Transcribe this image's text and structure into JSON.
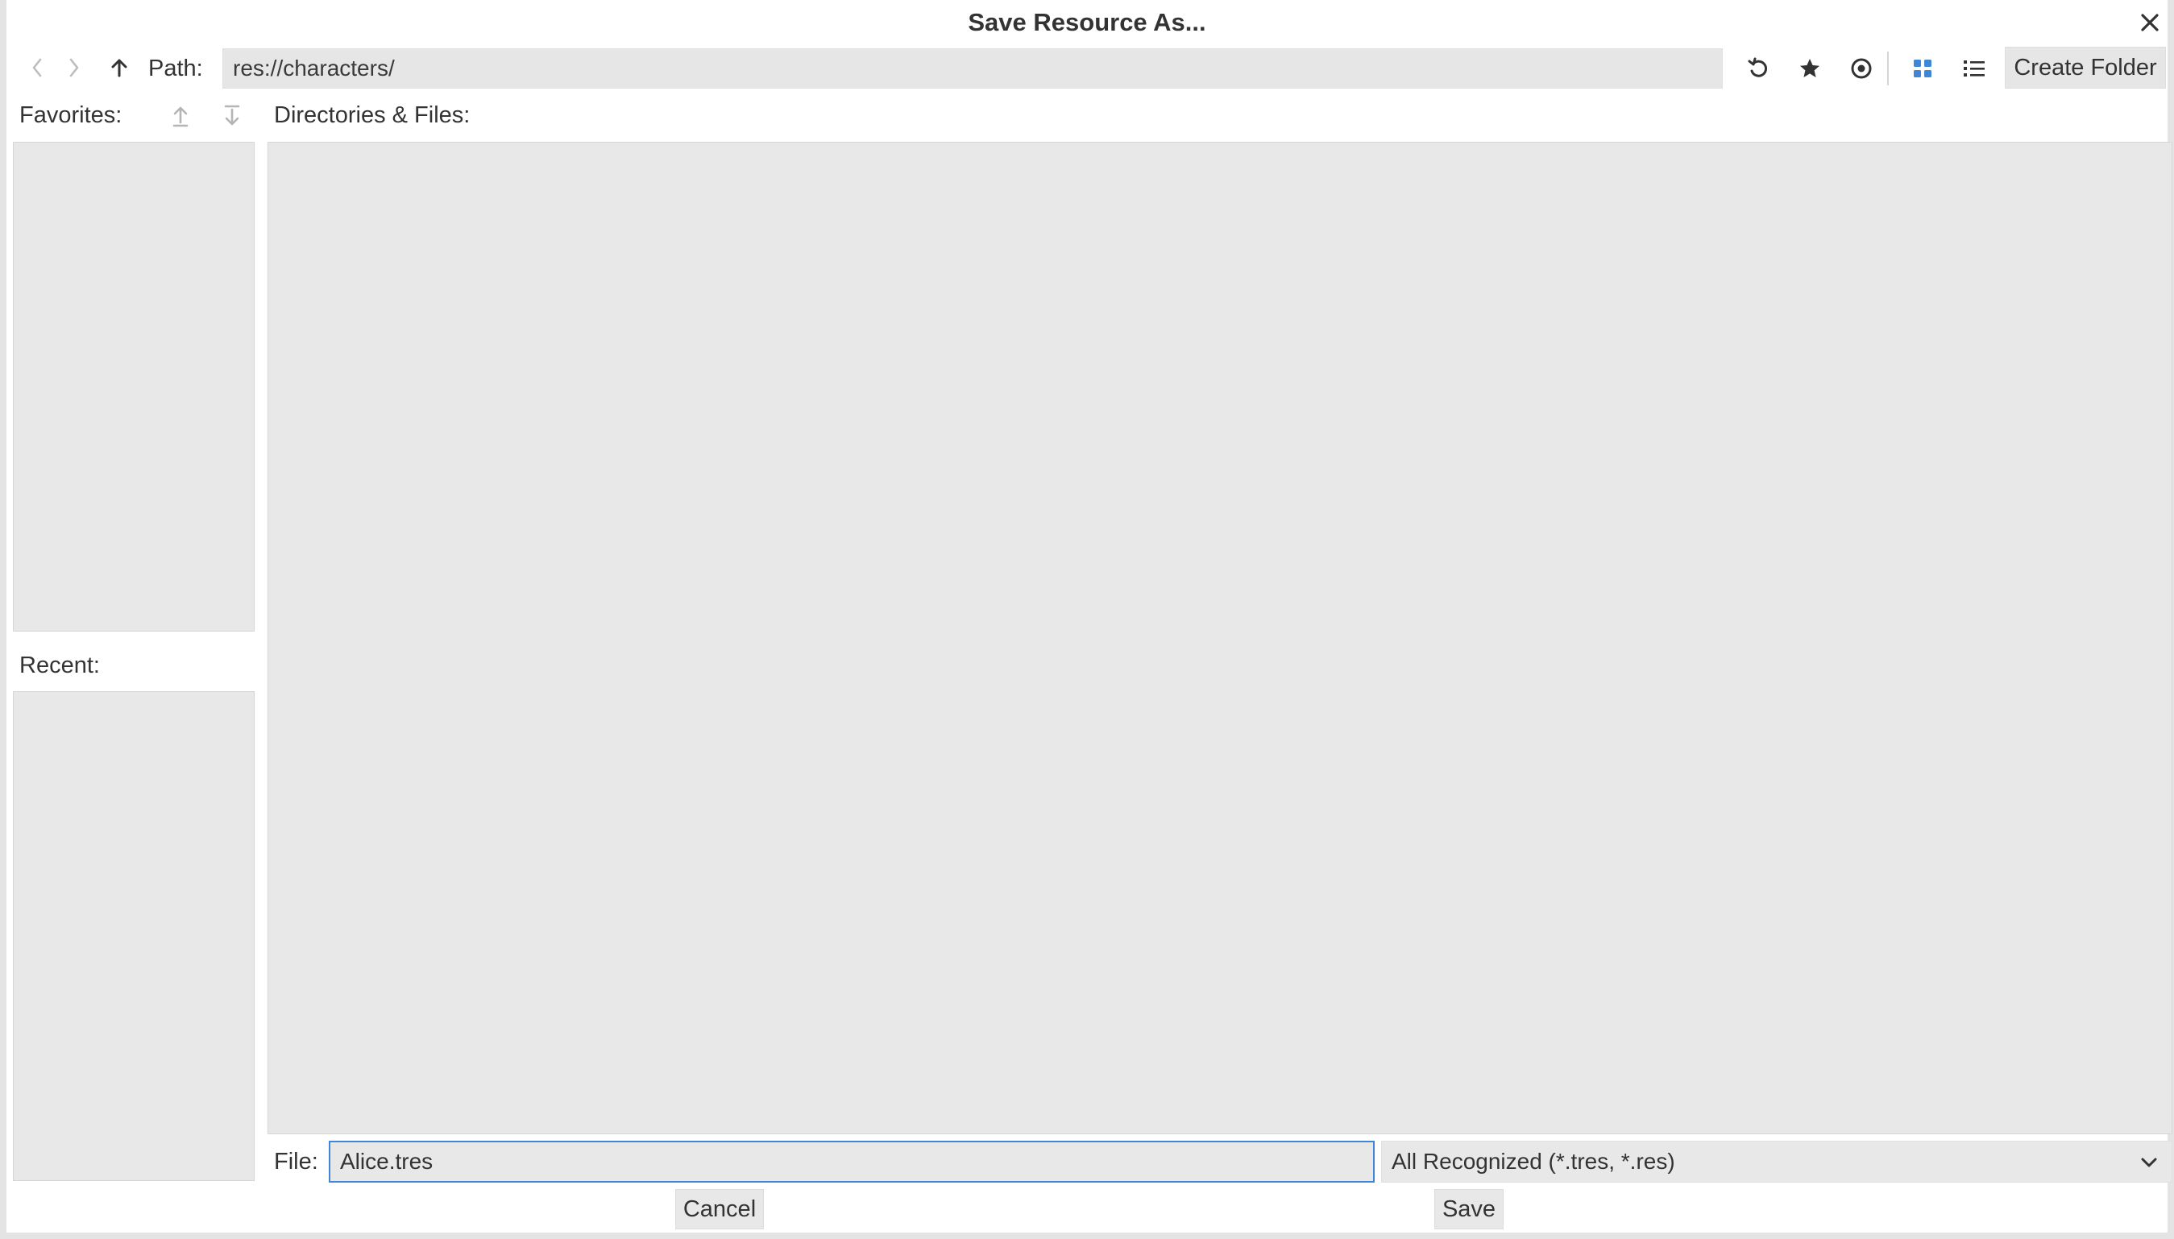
{
  "dialog": {
    "title": "Save Resource As..."
  },
  "toolbar": {
    "path_label": "Path:",
    "path_value": "res://characters/",
    "create_folder_label": "Create Folder"
  },
  "favorites": {
    "label": "Favorites:"
  },
  "recent": {
    "label": "Recent:"
  },
  "files": {
    "label": "Directories & Files:"
  },
  "footer": {
    "file_label": "File:",
    "file_value": "Alice.tres",
    "filter_selected": "All Recognized (*.tres, *.res)",
    "cancel_label": "Cancel",
    "save_label": "Save"
  },
  "colors": {
    "accent": "#3f87d6",
    "panel_bg": "#e8e8e8",
    "text": "#333333"
  },
  "icons": {
    "back": "chevron-left-icon",
    "forward": "chevron-right-icon",
    "up": "arrow-up-icon",
    "refresh": "refresh-icon",
    "favorite": "star-icon",
    "hidden_files": "eye-icon",
    "grid_view": "grid-view-icon",
    "list_view": "list-view-icon",
    "move_up": "move-up-icon",
    "move_down": "move-down-icon",
    "close": "close-icon",
    "dropdown": "chevron-down-icon"
  }
}
